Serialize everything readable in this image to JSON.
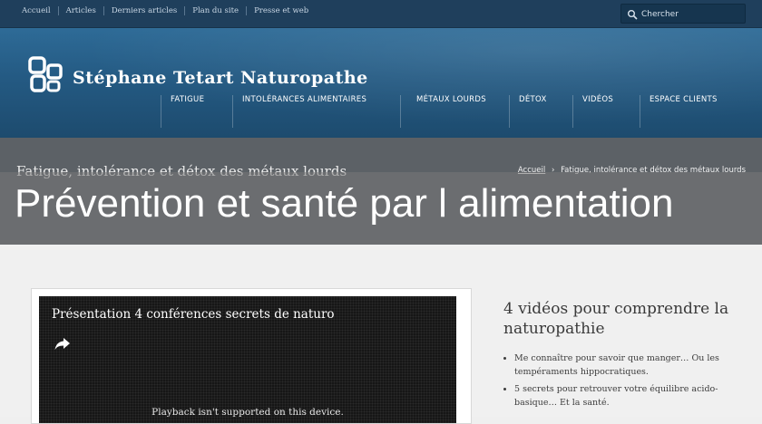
{
  "topnav": {
    "links": [
      "Accueil",
      "Articles",
      "Derniers articles",
      "Plan du site",
      "Presse et web"
    ]
  },
  "search": {
    "placeholder": "Chercher"
  },
  "brand": {
    "name": "Stéphane Tetart Naturopathe"
  },
  "mainnav": {
    "items": [
      "FATIGUE",
      "INTOLÉRANCES ALIMENTAIRES",
      "MÉTAUX LOURDS",
      "DÉTOX",
      "VIDÉOS",
      "ESPACE CLIENTS"
    ]
  },
  "page": {
    "title": "Fatigue, intolérance et détox des métaux lourds"
  },
  "breadcrumb": {
    "home": "Accueil",
    "separator": "›",
    "current": "Fatigue, intolérance et détox des métaux lourds"
  },
  "overlay": {
    "title": "Prévention et santé par l alimentation"
  },
  "video": {
    "title": "Présentation 4 conférences secrets de naturo",
    "message": "Playback isn't supported on this device."
  },
  "sidebar": {
    "heading": "4 vidéos pour comprendre la naturopathie",
    "items": [
      "Me connaître pour savoir que manger… Ou les tempéraments hippocratiques.",
      "5 secrets pour retrouver votre équilibre acido-basique… Et la santé."
    ]
  },
  "colors": {
    "topbar": "#1f3f5c",
    "hero": "#245a83",
    "subbar": "#5c6166"
  }
}
